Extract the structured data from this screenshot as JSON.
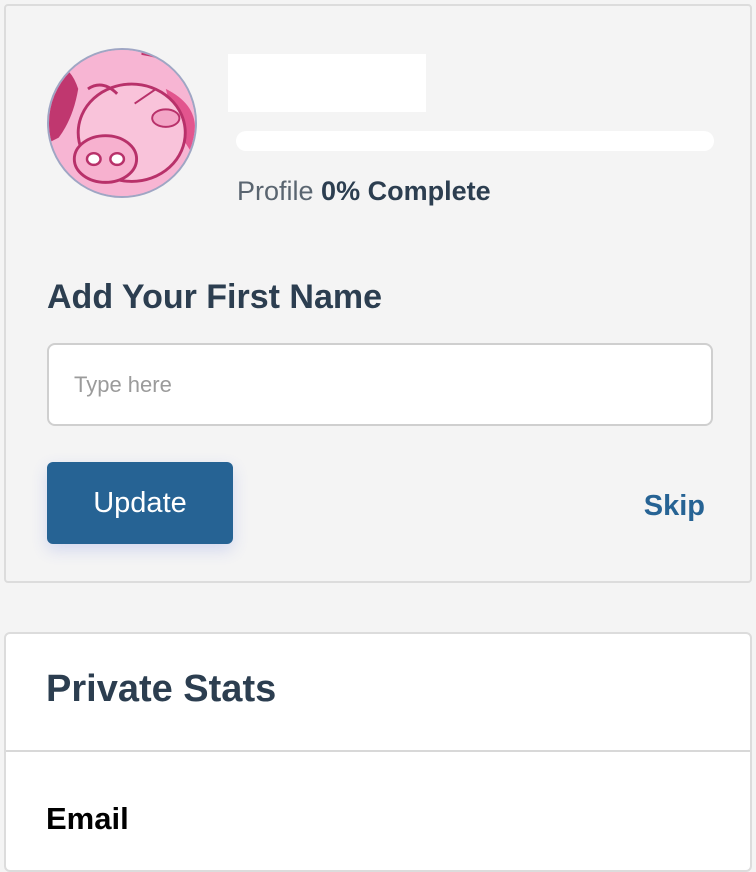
{
  "profile": {
    "avatar_icon": "pig-avatar-icon",
    "progress_prefix": "Profile",
    "progress_percent": "0% Complete",
    "progress_value": 0
  },
  "first_name_form": {
    "heading": "Add Your First Name",
    "placeholder": "Type here",
    "value": "",
    "update_label": "Update",
    "skip_label": "Skip"
  },
  "private_stats": {
    "title": "Private Stats",
    "email_label": "Email"
  },
  "colors": {
    "accent": "#266394",
    "heading": "#2c3e50",
    "avatar_bg": "#f7b5d3"
  }
}
